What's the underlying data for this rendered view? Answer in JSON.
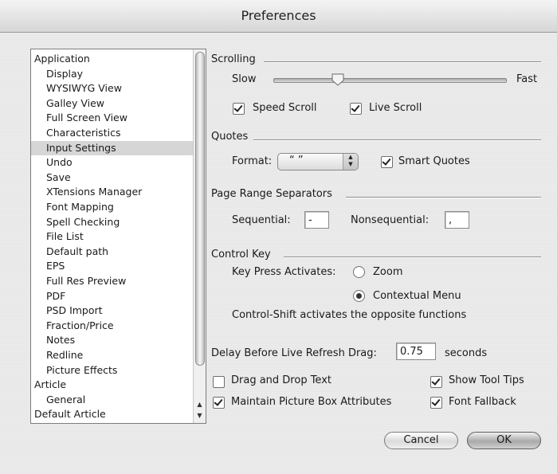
{
  "window": {
    "title": "Preferences"
  },
  "sidebar": {
    "items": [
      {
        "label": "Application",
        "level": 0
      },
      {
        "label": "Display",
        "level": 1
      },
      {
        "label": "WYSIWYG View",
        "level": 1
      },
      {
        "label": "Galley View",
        "level": 1
      },
      {
        "label": "Full Screen View",
        "level": 1
      },
      {
        "label": "Characteristics",
        "level": 1
      },
      {
        "label": "Input Settings",
        "level": 1,
        "selected": true
      },
      {
        "label": "Undo",
        "level": 1
      },
      {
        "label": "Save",
        "level": 1
      },
      {
        "label": "XTensions Manager",
        "level": 1
      },
      {
        "label": "Font Mapping",
        "level": 1
      },
      {
        "label": "Spell Checking",
        "level": 1
      },
      {
        "label": "File List",
        "level": 1
      },
      {
        "label": "Default path",
        "level": 1
      },
      {
        "label": "EPS",
        "level": 1
      },
      {
        "label": "Full Res Preview",
        "level": 1
      },
      {
        "label": "PDF",
        "level": 1
      },
      {
        "label": "PSD Import",
        "level": 1
      },
      {
        "label": "Fraction/Price",
        "level": 1
      },
      {
        "label": "Notes",
        "level": 1
      },
      {
        "label": "Redline",
        "level": 1
      },
      {
        "label": "Picture Effects",
        "level": 1
      },
      {
        "label": "Article",
        "level": 0
      },
      {
        "label": "General",
        "level": 1
      },
      {
        "label": "Default Article",
        "level": 0
      }
    ]
  },
  "scrolling": {
    "title": "Scrolling",
    "slow_label": "Slow",
    "fast_label": "Fast",
    "slider_value": 0.28,
    "speed_scroll": {
      "label": "Speed Scroll",
      "checked": true
    },
    "live_scroll": {
      "label": "Live Scroll",
      "checked": true
    }
  },
  "quotes": {
    "title": "Quotes",
    "format_label": "Format:",
    "format_value": "“ ”",
    "smart_quotes": {
      "label": "Smart Quotes",
      "checked": true
    }
  },
  "page_range": {
    "title": "Page Range Separators",
    "sequential_label": "Sequential:",
    "sequential_value": "-",
    "nonsequential_label": "Nonsequential:",
    "nonsequential_value": ","
  },
  "control_key": {
    "title": "Control Key",
    "activates_label": "Key Press Activates:",
    "zoom": {
      "label": "Zoom",
      "selected": false
    },
    "contextual": {
      "label": "Contextual Menu",
      "selected": true
    },
    "note": "Control-Shift activates the opposite functions"
  },
  "delay": {
    "label": "Delay Before Live Refresh Drag:",
    "value": "0.75",
    "unit": "seconds"
  },
  "options": {
    "drag_drop": {
      "label": "Drag and Drop Text",
      "checked": false
    },
    "tool_tips": {
      "label": "Show Tool Tips",
      "checked": true
    },
    "maintain_picture": {
      "label": "Maintain Picture Box Attributes",
      "checked": true
    },
    "font_fallback": {
      "label": "Font Fallback",
      "checked": true
    }
  },
  "buttons": {
    "cancel": "Cancel",
    "ok": "OK"
  }
}
